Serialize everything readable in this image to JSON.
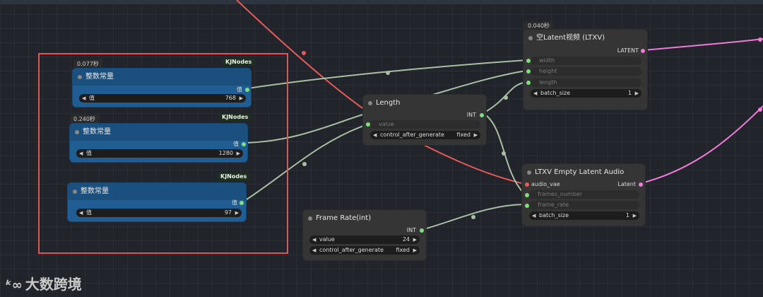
{
  "nodes": {
    "int1": {
      "timing": "0.077秒",
      "badge": "KJNodes",
      "title": "整数常量",
      "out_label": "值",
      "widget": {
        "label": "值",
        "value": "768"
      }
    },
    "int2": {
      "timing": "0.240秒",
      "badge": "KJNodes",
      "title": "整数常量",
      "out_label": "值",
      "widget": {
        "label": "值",
        "value": "1280"
      }
    },
    "int3": {
      "badge": "KJNodes",
      "title": "整数常量",
      "out_label": "值",
      "widget": {
        "label": "值",
        "value": "97"
      }
    },
    "length": {
      "title": "Length",
      "out_label": "INT",
      "input_placeholder": "value",
      "widget": {
        "label": "control_after_generate",
        "value": "fixed"
      }
    },
    "latent_video": {
      "timing": "0.040秒",
      "title": "空Latent视频 (LTXV)",
      "out_label": "LATENT",
      "inputs": [
        "width",
        "height",
        "length"
      ],
      "widget": {
        "label": "batch_size",
        "value": "1"
      }
    },
    "audio": {
      "title": "LTXV Empty Latent Audio",
      "input_label": "audio_vae",
      "out_label": "Latent",
      "inputs": [
        "frames_number",
        "frame_rate"
      ],
      "widget": {
        "label": "batch_size",
        "value": "1"
      }
    },
    "framerate": {
      "title": "Frame Rate(int)",
      "out_label": "INT",
      "widgets": [
        {
          "label": "value",
          "value": "24"
        },
        {
          "label": "control_after_generate",
          "value": "fixed"
        }
      ]
    }
  },
  "watermark": {
    "text": "大数跨境"
  },
  "colors": {
    "int_wire": "#a9bfa3",
    "red_wire": "#e65a5a",
    "latent_wire": "#f07ad8",
    "highlight": "#e05555"
  }
}
